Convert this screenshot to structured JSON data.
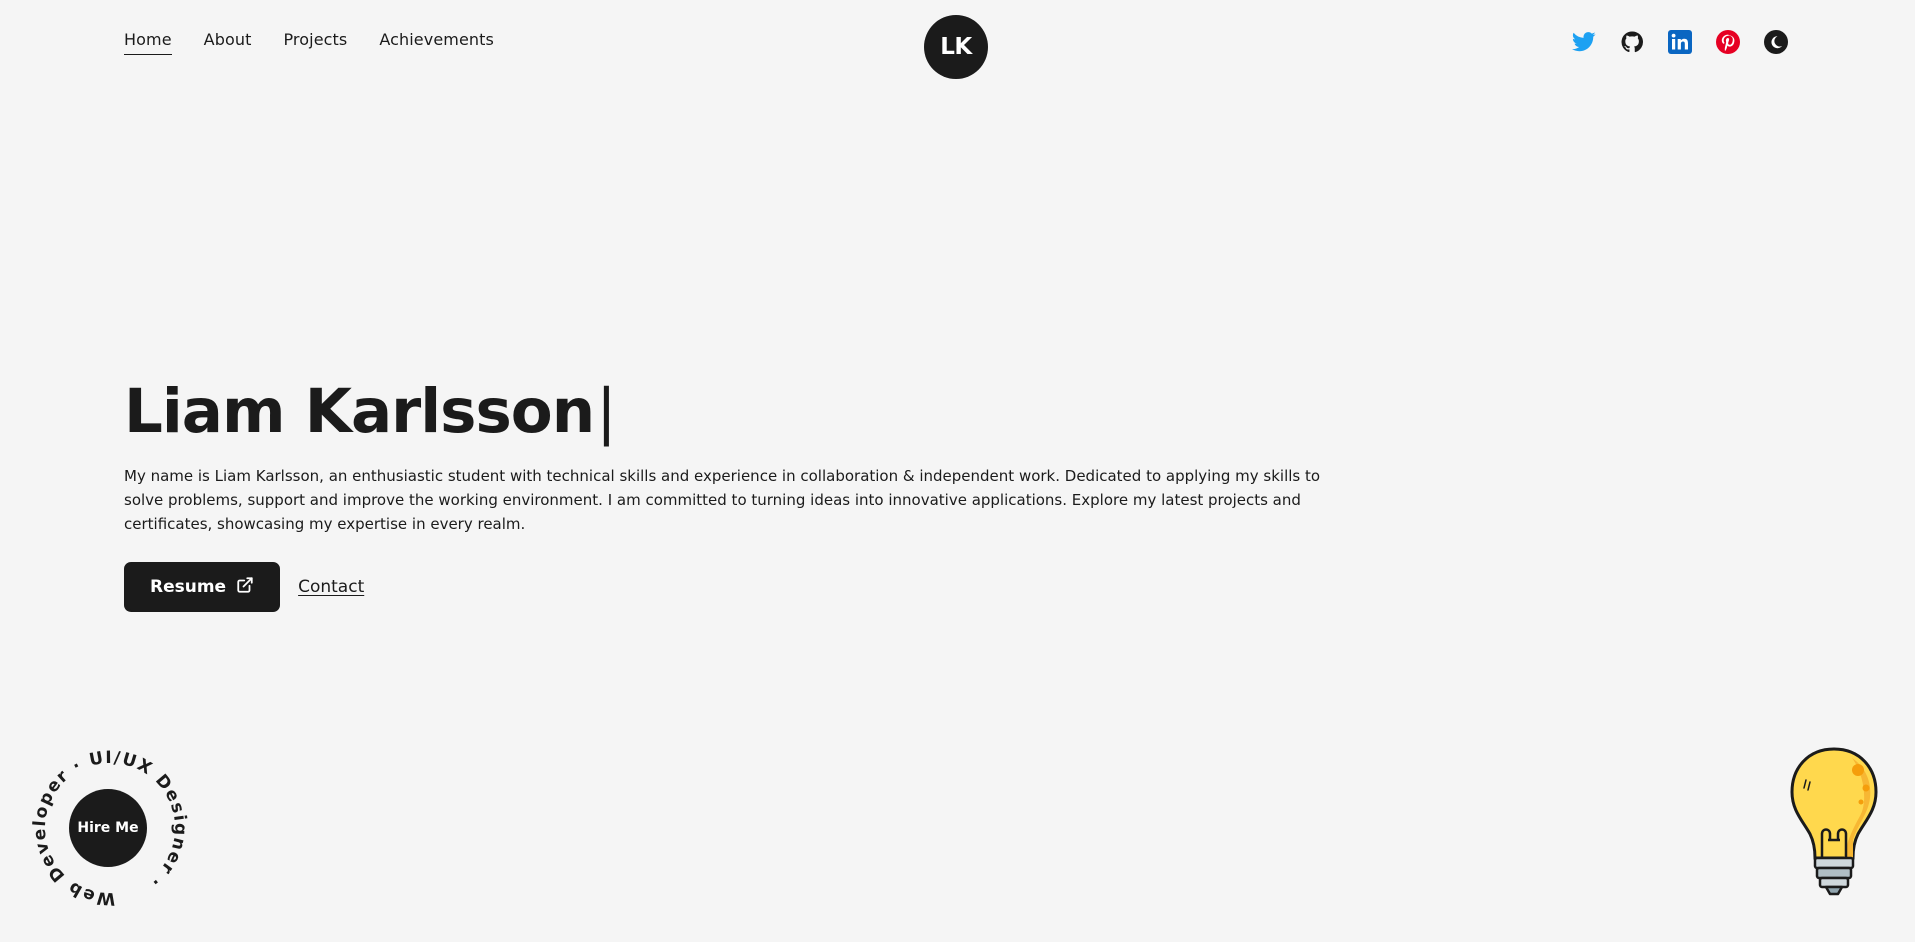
{
  "nav": {
    "items": [
      {
        "label": "Home",
        "active": true
      },
      {
        "label": "About"
      },
      {
        "label": "Projects"
      },
      {
        "label": "Achievements"
      }
    ]
  },
  "logo": {
    "text": "LK"
  },
  "socials": [
    "twitter-icon",
    "github-icon",
    "linkedin-icon",
    "pinterest-icon",
    "theme-toggle-icon"
  ],
  "hero": {
    "name": "Liam Karlsson",
    "cursor": "|",
    "description": "My name is Liam Karlsson, an enthusiastic student with technical skills and experience in collaboration & independent work. Dedicated to applying my skills to solve problems, support and improve the working environment. I am committed to turning ideas into innovative applications. Explore my latest projects and certificates, showcasing my expertise in every realm.",
    "resume_label": "Resume",
    "contact_label": "Contact"
  },
  "hire": {
    "button_label": "Hire Me",
    "ring_text": "Web Developer · UI/UX Designer · "
  },
  "colors": {
    "background": "#f5f5f5",
    "ink": "#1b1b1b",
    "twitter": "#1da1f2",
    "linkedin": "#0a66c2",
    "pinterest": "#e60023",
    "bulb": "#ffd84d"
  }
}
